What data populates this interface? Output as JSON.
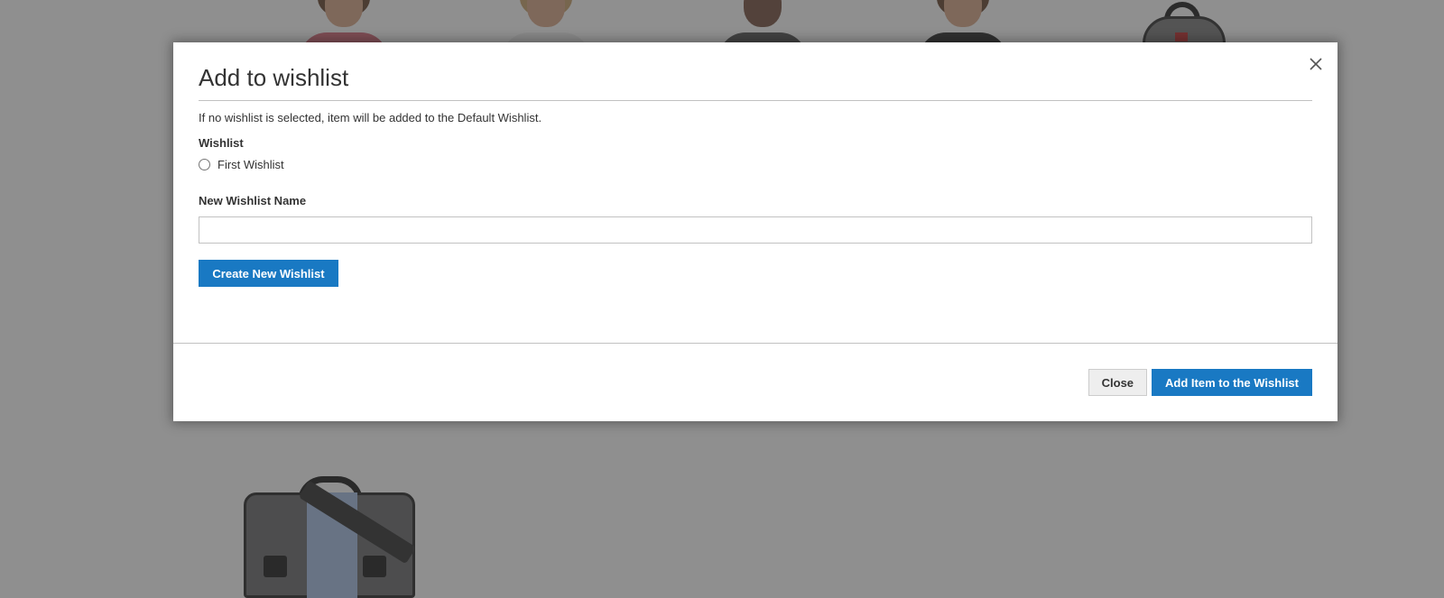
{
  "modal": {
    "title": "Add to wishlist",
    "notice": "If no wishlist is selected, item will be added to the Default Wishlist.",
    "wishlist_label": "Wishlist",
    "wishlist_options": [
      {
        "label": "First Wishlist",
        "selected": false
      }
    ],
    "new_wishlist_name_label": "New Wishlist Name",
    "new_wishlist_name_value": "",
    "create_button": "Create New Wishlist",
    "close_button": "Close",
    "add_button": "Add Item to the Wishlist",
    "close_icon": "close-icon"
  },
  "colors": {
    "primary": "#1979c3",
    "overlay": "#333333"
  }
}
